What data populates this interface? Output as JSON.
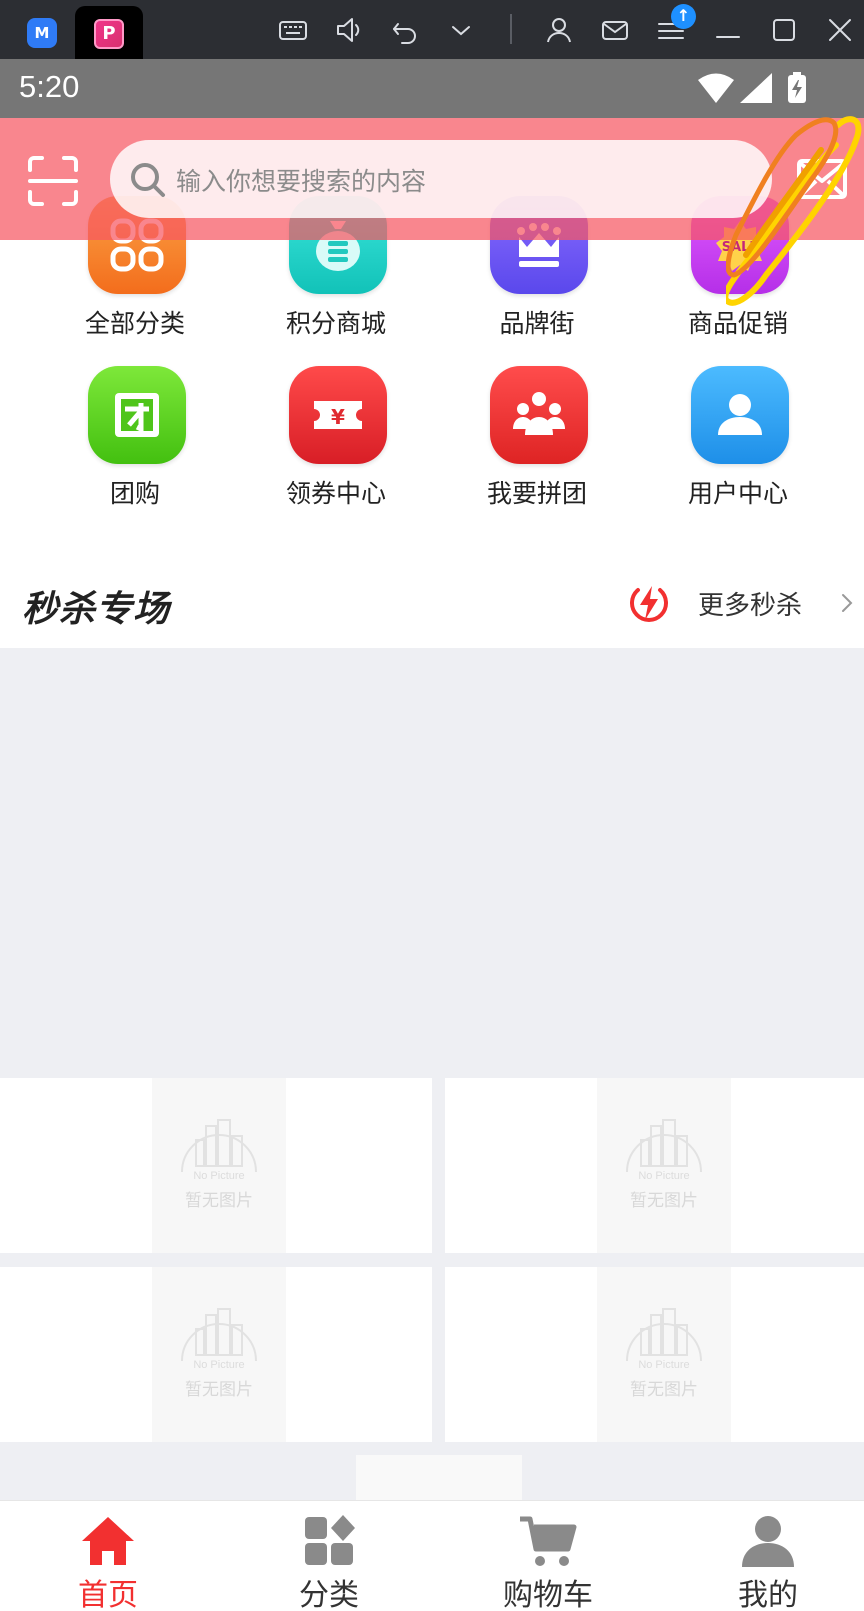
{
  "emulator": {
    "logo_text": "M",
    "app_tab_letter": "P",
    "notification_badge": "↑",
    "icons": [
      "keyboard-icon",
      "volume-icon",
      "undo-icon",
      "chevron-down-icon",
      "user-icon",
      "mail-icon",
      "menu-icon",
      "minimize-icon",
      "maximize-icon",
      "close-icon"
    ]
  },
  "status_bar": {
    "time": "5:20",
    "icons": [
      "wifi-icon",
      "signal-icon",
      "battery-charging-icon"
    ]
  },
  "header": {
    "search_placeholder": "输入你想要搜索的内容",
    "icons": [
      "scan-icon",
      "search-icon",
      "message-icon"
    ],
    "color": "#f65862"
  },
  "nav_grid": [
    {
      "label": "全部分类",
      "icon": "all-categories-icon",
      "color": "#f7892b"
    },
    {
      "label": "积分商城",
      "icon": "points-mall-icon",
      "color": "#22d3c7"
    },
    {
      "label": "品牌街",
      "icon": "brand-crown-icon",
      "color": "#6a5cf6"
    },
    {
      "label": "商品促销",
      "icon": "sale-tag-icon",
      "color": "#c53cf0"
    },
    {
      "label": "团购",
      "icon": "group-buy-icon",
      "color": "#5fd11a"
    },
    {
      "label": "领券中心",
      "icon": "coupon-icon",
      "color": "#ea2f38"
    },
    {
      "label": "我要拼团",
      "icon": "team-up-icon",
      "color": "#ee3535"
    },
    {
      "label": "用户中心",
      "icon": "user-center-icon",
      "color": "#2aa0f0"
    }
  ],
  "flash_sale": {
    "title": "秒杀专场",
    "more_label": "更多秒杀",
    "accent": "#f23030"
  },
  "products": {
    "placeholder_en": "No Picture",
    "placeholder_cn": "暂无图片"
  },
  "tab_bar": {
    "tabs": [
      {
        "label": "首页",
        "icon": "home-icon",
        "active": true
      },
      {
        "label": "分类",
        "icon": "category-icon",
        "active": false
      },
      {
        "label": "购物车",
        "icon": "cart-icon",
        "active": false
      },
      {
        "label": "我的",
        "icon": "profile-icon",
        "active": false
      }
    ],
    "active_color": "#f23030"
  }
}
